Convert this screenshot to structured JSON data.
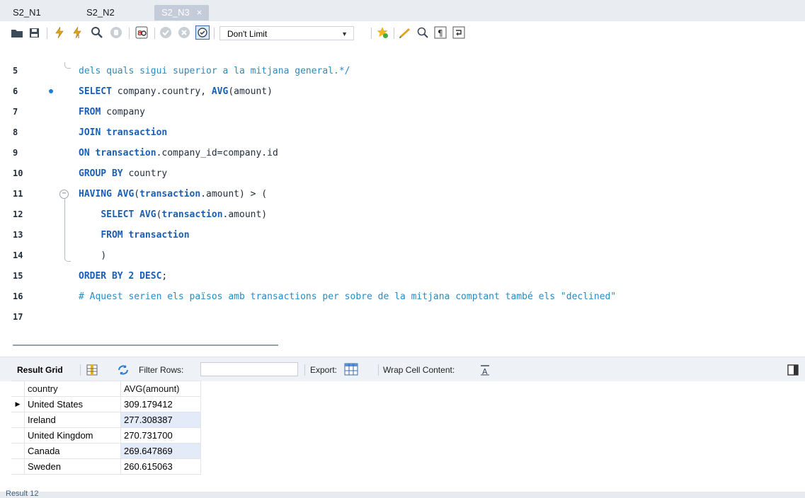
{
  "tabs": [
    {
      "label": "S2_N1",
      "active": false
    },
    {
      "label": "S2_N2",
      "active": false
    },
    {
      "label": "S2_N3",
      "active": true
    }
  ],
  "toolbar": {
    "limit_value": "Don't Limit",
    "icons": [
      "folder-icon",
      "save-icon",
      "execute-icon",
      "execute-current-icon",
      "explain-icon",
      "stop-icon",
      "toggle-error-icon",
      "commit-icon",
      "rollback-icon",
      "autocommit-icon",
      "bookmark-icon",
      "beautify-icon",
      "find-icon",
      "invisible-chars-icon",
      "wrap-icon"
    ]
  },
  "editor": {
    "lines": [
      {
        "num": "5",
        "text": "dels quals sigui superior a la mitjana general.*/"
      },
      {
        "num": "6",
        "text": "SELECT company.country, AVG(amount)"
      },
      {
        "num": "7",
        "text": "FROM company"
      },
      {
        "num": "8",
        "text": "JOIN transaction"
      },
      {
        "num": "9",
        "text": "ON transaction.company_id=company.id"
      },
      {
        "num": "10",
        "text": "GROUP BY country"
      },
      {
        "num": "11",
        "text": "HAVING AVG(transaction.amount) > ("
      },
      {
        "num": "12",
        "text": "SELECT AVG(transaction.amount)"
      },
      {
        "num": "13",
        "text": "FROM transaction"
      },
      {
        "num": "14",
        "text": ")"
      },
      {
        "num": "15",
        "text": "ORDER BY 2 DESC;"
      },
      {
        "num": "16",
        "text": "# Aquest serien els països amb transactions per sobre de la mitjana comptant també els \"declined\""
      },
      {
        "num": "17",
        "text": ""
      }
    ]
  },
  "result_toolbar": {
    "result_grid_label": "Result Grid",
    "filter_rows_label": "Filter Rows:",
    "filter_value": "",
    "export_label": "Export:",
    "wrap_label": "Wrap Cell Content:"
  },
  "result_grid": {
    "columns": [
      "country",
      "AVG(amount)"
    ],
    "rows": [
      [
        "United States",
        "309.179412"
      ],
      [
        "Ireland",
        "277.308387"
      ],
      [
        "United Kingdom",
        "270.731700"
      ],
      [
        "Canada",
        "269.647869"
      ],
      [
        "Sweden",
        "260.615063"
      ]
    ]
  },
  "status": {
    "text": "Result 12"
  },
  "colors": {
    "keyword": "#1a5fb4",
    "comment": "#2a8bbf",
    "accent": "#1a7fd9"
  }
}
